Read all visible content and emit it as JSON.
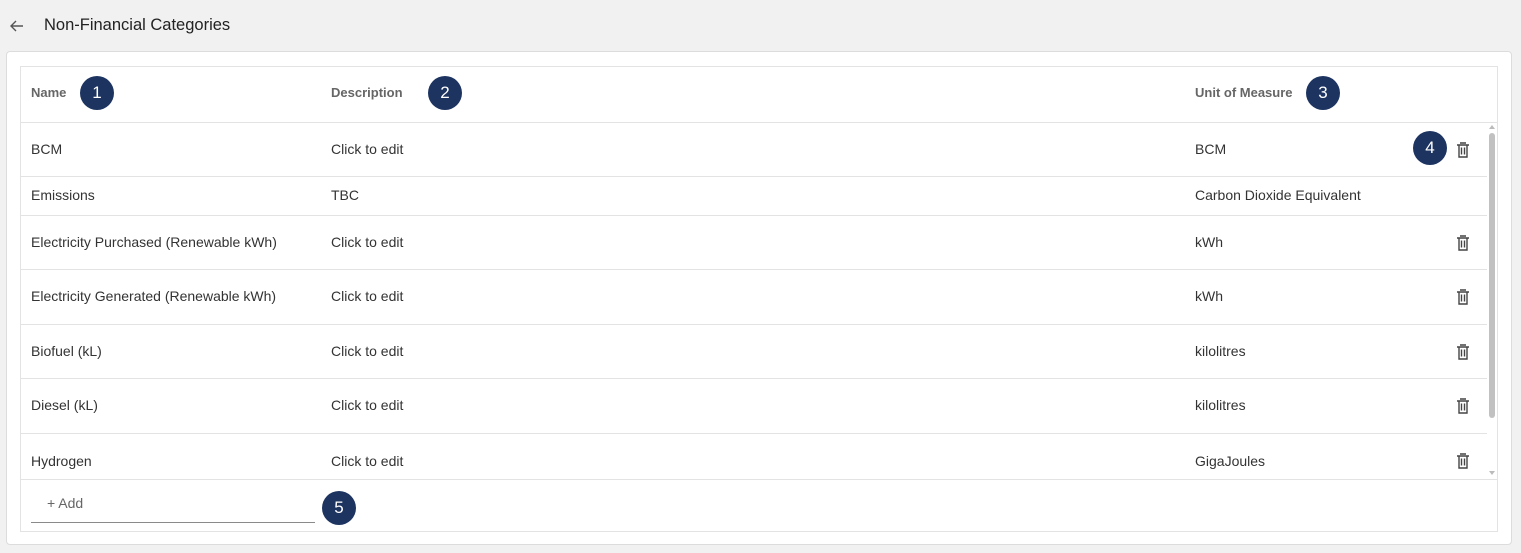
{
  "header": {
    "title": "Non-Financial Categories",
    "back_icon": "arrow-left-icon"
  },
  "table": {
    "columns": {
      "name": "Name",
      "description": "Description",
      "unit": "Unit of Measure"
    },
    "rows": [
      {
        "name": "BCM",
        "description": "Click to edit",
        "unit": "BCM",
        "deletable": true
      },
      {
        "name": "Emissions",
        "description": "TBC",
        "unit": "Carbon Dioxide Equivalent",
        "deletable": false
      },
      {
        "name": "Electricity Purchased (Renewable kWh)",
        "description": "Click to edit",
        "unit": "kWh",
        "deletable": true
      },
      {
        "name": "Electricity Generated (Renewable kWh)",
        "description": "Click to edit",
        "unit": "kWh",
        "deletable": true
      },
      {
        "name": "Biofuel (kL)",
        "description": "Click to edit",
        "unit": "kilolitres",
        "deletable": true
      },
      {
        "name": "Diesel (kL)",
        "description": "Click to edit",
        "unit": "kilolitres",
        "deletable": true
      },
      {
        "name": "Hydrogen",
        "description": "Click to edit",
        "unit": "GigaJoules",
        "deletable": true
      }
    ],
    "add_placeholder": "+ Add"
  },
  "annotations": {
    "badge1": "1",
    "badge2": "2",
    "badge3": "3",
    "badge4": "4",
    "badge5": "5",
    "color": "#1d3461"
  },
  "icons": {
    "delete": "trash-icon"
  }
}
